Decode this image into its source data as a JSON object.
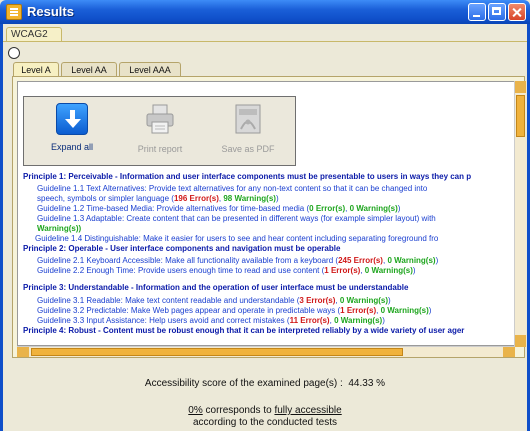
{
  "window": {
    "title": "Results"
  },
  "outer_tab": {
    "label": "WCAG2"
  },
  "level_tabs": [
    {
      "label": "Level A",
      "active": true
    },
    {
      "label": "Level AA",
      "active": false
    },
    {
      "label": "Level AAA",
      "active": false
    }
  ],
  "toolbar": {
    "expand_label": "Expand all",
    "print_label": "Print report",
    "pdf_label": "Save as PDF"
  },
  "results": {
    "p1": "Principle 1: Perceivable - Information and user interface components must be presentable to users in ways they can p",
    "g1_1a": "Guideline 1.1 Text Alternatives: Provide text alternatives for any non-text content so that it can be changed into",
    "g1_1b": "speech, symbols or simpler language (",
    "g1_1_err": "196 Error(s)",
    "g1_1_warn": "98 Warning(s)",
    "g1_2": "Guideline 1.2 Time-based Media: Provide alternatives for time-based media (",
    "g1_2_err": "0 Error(s)",
    "g1_2_warn": "0 Warning(s)",
    "g1_3": "Guideline 1.3 Adaptable: Create content that can be presented in different ways (for example simpler layout) with",
    "g1_3_warn": "Warning(s))",
    "g1_4": "Guideline 1.4 Distinguishable: Make it easier for users to see and hear content including separating foreground fro",
    "p2": "Principle 2: Operable - User interface components and navigation must be operable",
    "g2_1": "Guideline 2.1 Keyboard Accessible: Make all functionality available from a keyboard (",
    "g2_1_err": "245 Error(s)",
    "g2_1_warn": "0 Warning(s)",
    "g2_2": "Guideline 2.2 Enough Time: Provide users enough time to read and use content (",
    "g2_2_err": "1 Error(s)",
    "g2_2_warn": "0 Warning(s)",
    "p3": "Principle 3: Understandable - Information and the operation of user interface must be understandable",
    "g3_1": "Guideline 3.1 Readable: Make text content readable and understandable (",
    "g3_1_err": "3 Error(s)",
    "g3_1_warn": "0 Warning(s)",
    "g3_2": "Guideline 3.2 Predictable: Make Web pages appear and operate in predictable ways (",
    "g3_2_err": "1 Error(s)",
    "g3_2_warn": "0 Warning(s)",
    "g3_3": "Guideline 3.3 Input Assistance: Help users avoid and correct mistakes (",
    "g3_3_err": "11 Error(s)",
    "g3_3_warn": "0 Warning(s)",
    "p4": "Principle 4: Robust - Content must be robust enough that it can be interpreted reliably by a wide variety of user ager"
  },
  "score": {
    "label": "Accessibility score of the examined page(s) :",
    "value": "44.33 %",
    "note_pct": "0%",
    "note_mid": " corresponds to ",
    "note_link": "fully accessible",
    "note_line2": "according to the conducted tests"
  },
  "colors": {
    "error": "#d01818",
    "warning": "#1ea51e",
    "principle": "#0a1aa8",
    "guideline": "#1a3fd0",
    "titlebar": "#0f4fc9"
  }
}
